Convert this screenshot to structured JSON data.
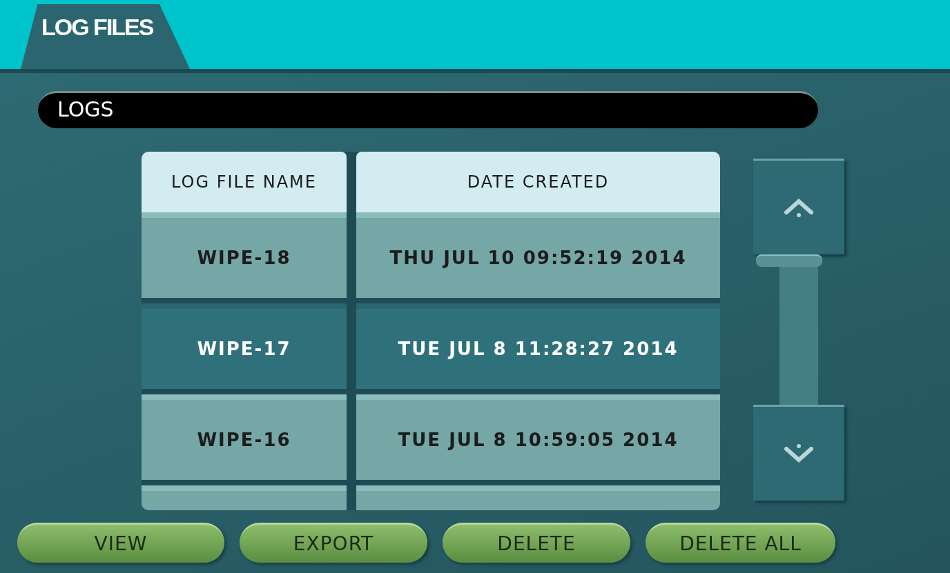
{
  "tabs": [
    {
      "label": "LOG FILES",
      "selected": true
    }
  ],
  "section_title": "LOGS",
  "table": {
    "columns": [
      "LOG FILE NAME",
      "DATE CREATED"
    ],
    "rows": [
      {
        "cells": [
          "WIPE-18",
          "THU JUL 10 09:52:19 2014"
        ],
        "selected": false
      },
      {
        "cells": [
          "WIPE-17",
          "TUE JUL 8 11:28:27 2014"
        ],
        "selected": true
      },
      {
        "cells": [
          "WIPE-16",
          "TUE JUL 8 10:59:05 2014"
        ],
        "selected": false
      }
    ]
  },
  "buttons": [
    "VIEW",
    "EXPORT",
    "DELETE",
    "DELETE ALL"
  ]
}
